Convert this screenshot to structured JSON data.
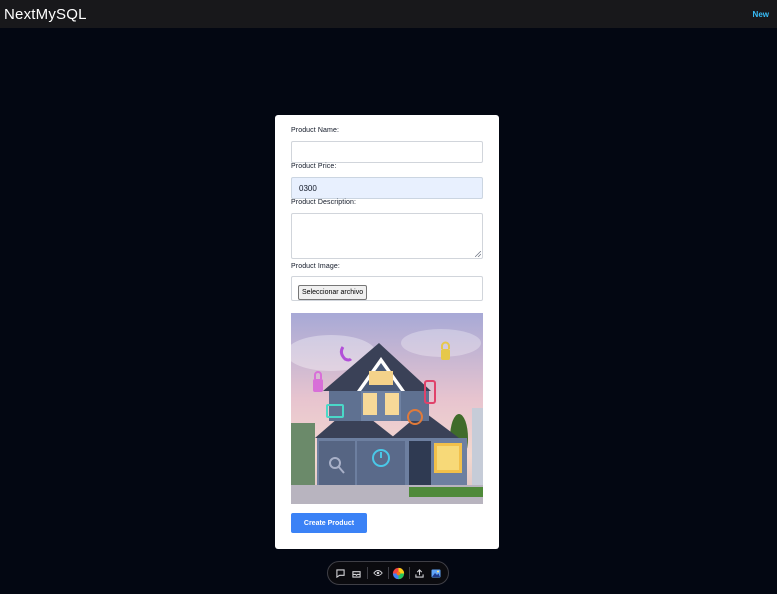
{
  "navbar": {
    "brand": "NextMySQL",
    "link": "New"
  },
  "form": {
    "name_label": "Product Name:",
    "name_value": "",
    "price_label": "Product Price:",
    "price_value": "0300",
    "description_label": "Product Description:",
    "description_value": "",
    "image_label": "Product Image:",
    "file_button": "Seleccionar archivo",
    "submit_label": "Create Product"
  },
  "toolbar": {
    "icons": [
      "chat-icon",
      "inbox-icon",
      "eye-icon",
      "color-wheel-icon",
      "share-icon",
      "image-icon"
    ]
  }
}
